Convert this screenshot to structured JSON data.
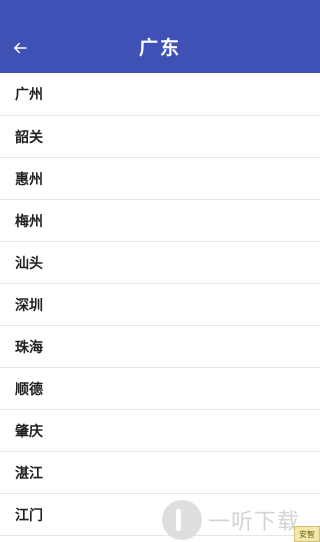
{
  "header": {
    "title": "广东",
    "back_icon": "arrow-left-icon",
    "background_color": "#3f51b5"
  },
  "cities": [
    {
      "name": "广州"
    },
    {
      "name": "韶关"
    },
    {
      "name": "惠州"
    },
    {
      "name": "梅州"
    },
    {
      "name": "汕头"
    },
    {
      "name": "深圳"
    },
    {
      "name": "珠海"
    },
    {
      "name": "顺德"
    },
    {
      "name": "肇庆"
    },
    {
      "name": "湛江"
    },
    {
      "name": "江门"
    }
  ],
  "watermark": {
    "text": "一听下载",
    "badge": "安智"
  }
}
